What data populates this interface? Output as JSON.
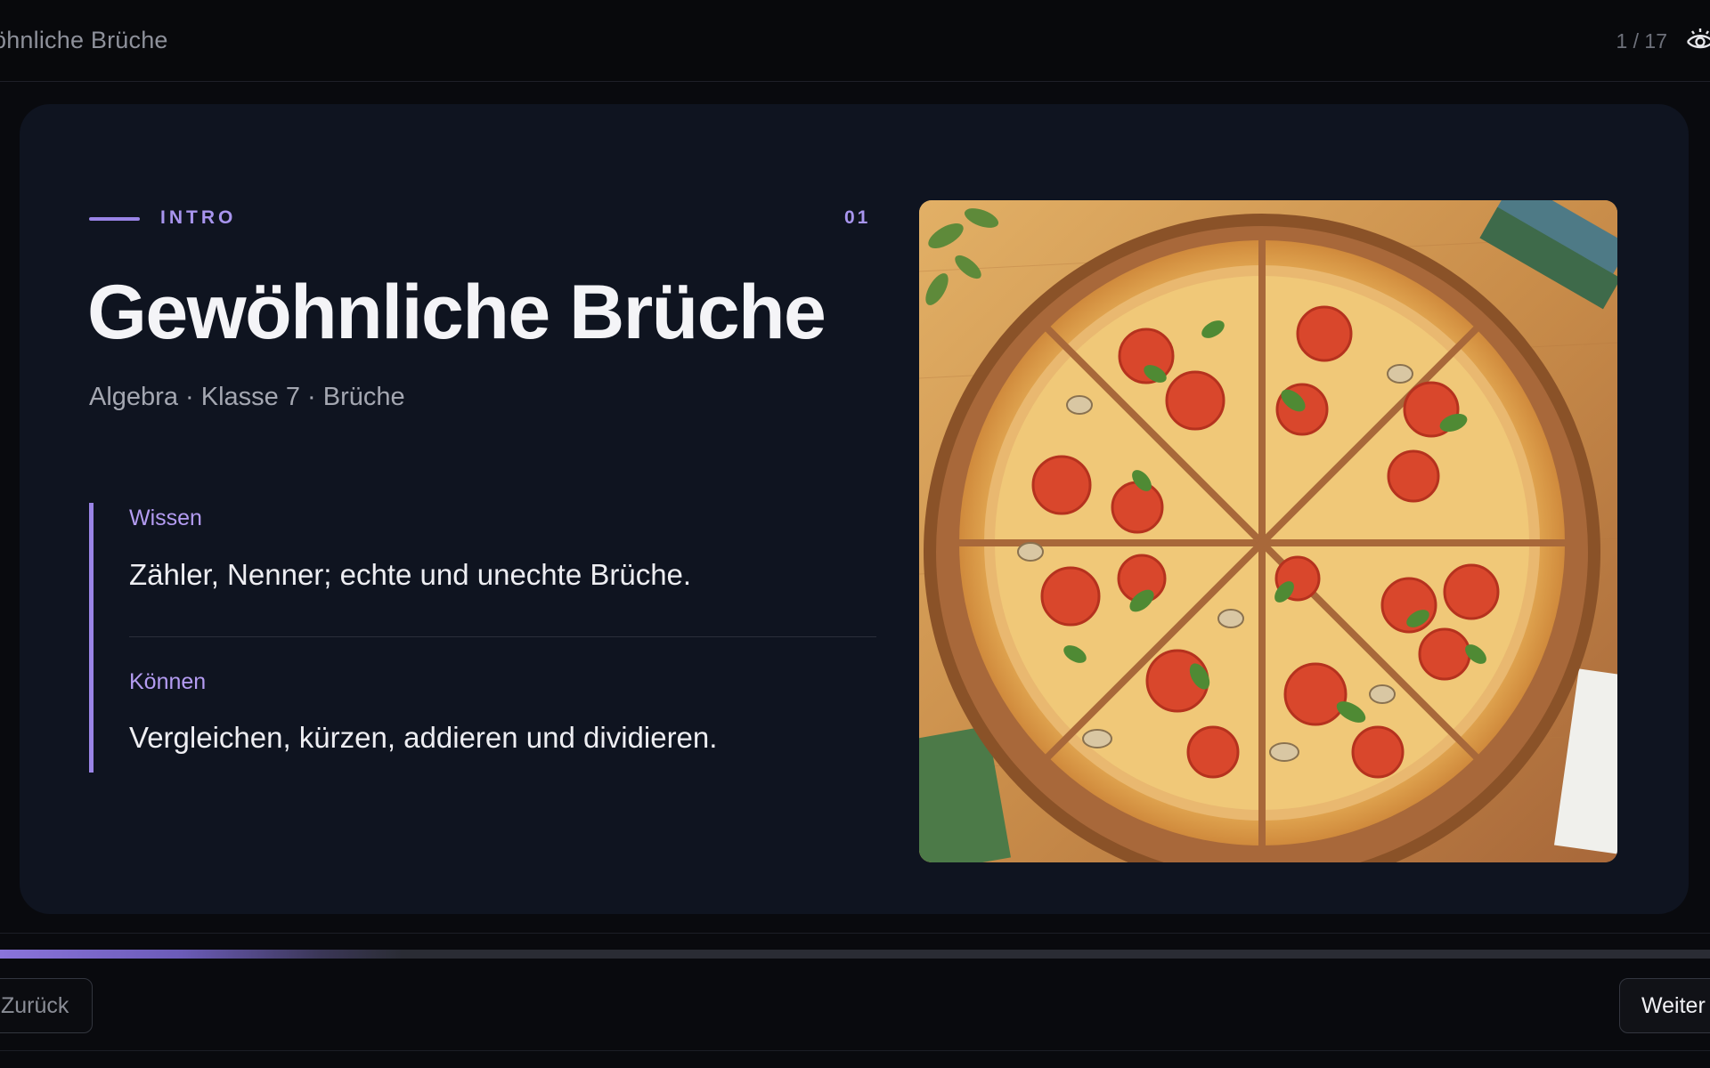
{
  "header": {
    "title": "öhnliche Brüche",
    "counter": "1 / 17",
    "icon": "eye-icon"
  },
  "slide": {
    "eyebrow": "INTRO",
    "number": "01",
    "headline": "Gewöhnliche Brüche",
    "subtitle": "Algebra · Klasse 7 · Brüche",
    "goals": [
      {
        "label": "Wissen",
        "text": "Zähler, Nenner; echte und unechte Brüche."
      },
      {
        "label": "Können",
        "text": "Vergleichen, kürzen, addieren und dividieren."
      }
    ],
    "image": "pizza-illustration"
  },
  "progress": {
    "value": 0.0588
  },
  "footer": {
    "back_label": "Zurück",
    "next_label": "Weiter"
  },
  "colors": {
    "accent": "#9a84e6",
    "card_bg": "#0f1420",
    "page_bg": "#090a0e"
  }
}
